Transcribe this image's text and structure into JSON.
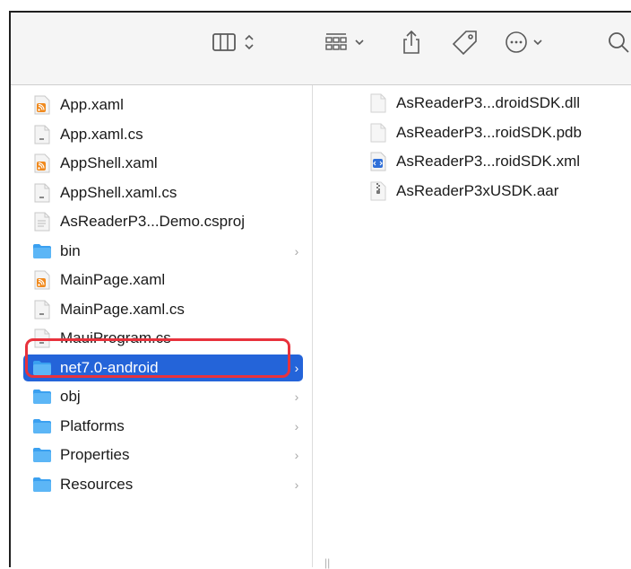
{
  "toolbar": {
    "buttons": [
      {
        "name": "view-columns",
        "icon": "columns-view-icon"
      },
      {
        "name": "group",
        "icon": "grid-group-icon"
      },
      {
        "name": "share",
        "icon": "share-icon"
      },
      {
        "name": "tag",
        "icon": "tag-icon"
      },
      {
        "name": "more",
        "icon": "ellipsis-circle-icon"
      },
      {
        "name": "search",
        "icon": "search-icon"
      }
    ]
  },
  "column1": {
    "items": [
      {
        "label": "App.xaml",
        "icon": "xml-feed-file-icon"
      },
      {
        "label": "App.xaml.cs",
        "icon": "cs-file-icon"
      },
      {
        "label": "AppShell.xaml",
        "icon": "xml-feed-file-icon"
      },
      {
        "label": "AppShell.xaml.cs",
        "icon": "cs-file-icon"
      },
      {
        "label": "AsReaderP3...Demo.csproj",
        "icon": "csproj-file-icon"
      },
      {
        "label": "bin",
        "icon": "folder-icon",
        "folder": true
      },
      {
        "label": "MainPage.xaml",
        "icon": "xml-feed-file-icon"
      },
      {
        "label": "MainPage.xaml.cs",
        "icon": "cs-file-icon"
      },
      {
        "label": "MauiProgram.cs",
        "icon": "cs-file-icon"
      },
      {
        "label": "net7.0-android",
        "icon": "folder-icon",
        "folder": true,
        "selected": true
      },
      {
        "label": "obj",
        "icon": "folder-icon",
        "folder": true
      },
      {
        "label": "Platforms",
        "icon": "folder-icon",
        "folder": true
      },
      {
        "label": "Properties",
        "icon": "folder-icon",
        "folder": true
      },
      {
        "label": "Resources",
        "icon": "folder-icon",
        "folder": true
      }
    ]
  },
  "column2": {
    "items": [
      {
        "label": "AsReaderP3...droidSDK.dll",
        "icon": "dll-file-icon"
      },
      {
        "label": "AsReaderP3...roidSDK.pdb",
        "icon": "pdb-file-icon"
      },
      {
        "label": "AsReaderP3...roidSDK.xml",
        "icon": "xml-file-icon"
      },
      {
        "label": "AsReaderP3xUSDK.aar",
        "icon": "archive-file-icon"
      }
    ]
  },
  "chevron": "›",
  "colors": {
    "selection": "#2464d9",
    "highlight": "#e8323c",
    "folder": "#3aa0f0"
  }
}
